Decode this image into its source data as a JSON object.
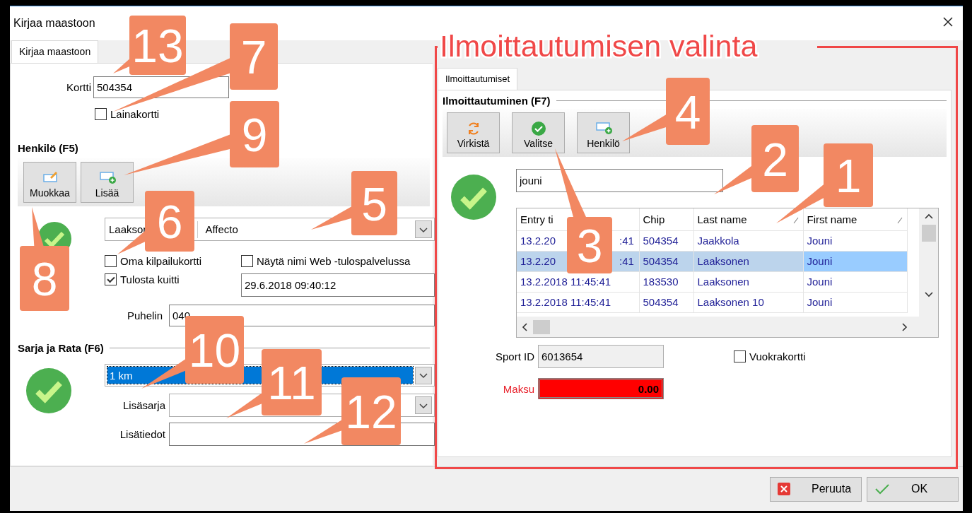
{
  "window": {
    "title": "Kirjaa maastoon"
  },
  "left": {
    "tab": {
      "label": "Kirjaa maastoon",
      "selected": true
    },
    "card": {
      "label": "Kortti",
      "value": "504354"
    },
    "loan_card": {
      "label": "Lainakortti",
      "checked": false
    },
    "person": {
      "heading": "Henkilö (F5)",
      "buttons": [
        {
          "label": "Muokkaa",
          "kind": "edit"
        },
        {
          "label": "Lisää",
          "kind": "add"
        }
      ],
      "valid": true,
      "combo": [
        "Laaksor",
        "Affecto"
      ],
      "own_card": {
        "label": "Oma kilpailukortti",
        "checked": false
      },
      "show_web": {
        "label": "Näytä nimi Web -tulospalvelussa",
        "checked": false
      },
      "print_receipt": {
        "label": "Tulosta kuitti",
        "checked": true
      },
      "timestamp": "29.6.2018 09:40:12",
      "phone": {
        "label": "Puhelin",
        "value": "040"
      }
    },
    "series": {
      "heading": "Sarja ja Rata (F6)",
      "valid": true,
      "course": {
        "value": "1 km",
        "selected": true
      },
      "extra_series": {
        "label": "Lisäsarja"
      },
      "extra_info": {
        "label": "Lisätiedot"
      }
    }
  },
  "right": {
    "section_title": "Ilmoittautumisen valinta",
    "tab": {
      "label": "Ilmoittautumiset",
      "selected": true
    },
    "heading": "Ilmoittautuminen (F7)",
    "buttons": [
      {
        "label": "Virkistä",
        "kind": "refresh"
      },
      {
        "label": "Valitse",
        "kind": "select"
      },
      {
        "label": "Henkilö",
        "kind": "add"
      }
    ],
    "valid": true,
    "search": {
      "value": "jouni"
    },
    "table": {
      "columns": [
        "Entry ti",
        "Chip",
        "Last name",
        "First name"
      ],
      "rows": [
        {
          "cells": [
            [
              "13.2.20",
              ":41"
            ],
            "504354",
            "Jaakkola",
            "Jouni"
          ],
          "selected": false
        },
        {
          "cells": [
            [
              "13.2.20",
              ":41"
            ],
            "504354",
            "Laaksonen",
            "Jouni"
          ],
          "selected": true
        },
        {
          "cells": [
            "13.2.2018 11:45:41",
            "183530",
            "Laaksonen",
            "Jouni"
          ],
          "selected": false
        },
        {
          "cells": [
            "13.2.2018 11:45:41",
            "504354",
            "Laaksonen 10",
            "Jouni"
          ],
          "selected": false
        }
      ]
    },
    "sport_id": {
      "label": "Sport ID",
      "value": "6013654"
    },
    "rental_card": {
      "label": "Vuokrakortti",
      "checked": false
    },
    "payment": {
      "label": "Maksu",
      "value": "0.00"
    }
  },
  "footer": {
    "buttons": [
      {
        "label": "Peruuta",
        "kind": "cancel"
      },
      {
        "label": "OK",
        "kind": "ok"
      }
    ]
  },
  "callouts": [
    "13",
    "7",
    "9",
    "8",
    "6",
    "5",
    "10",
    "11",
    "12",
    "4",
    "2",
    "1",
    "3"
  ]
}
